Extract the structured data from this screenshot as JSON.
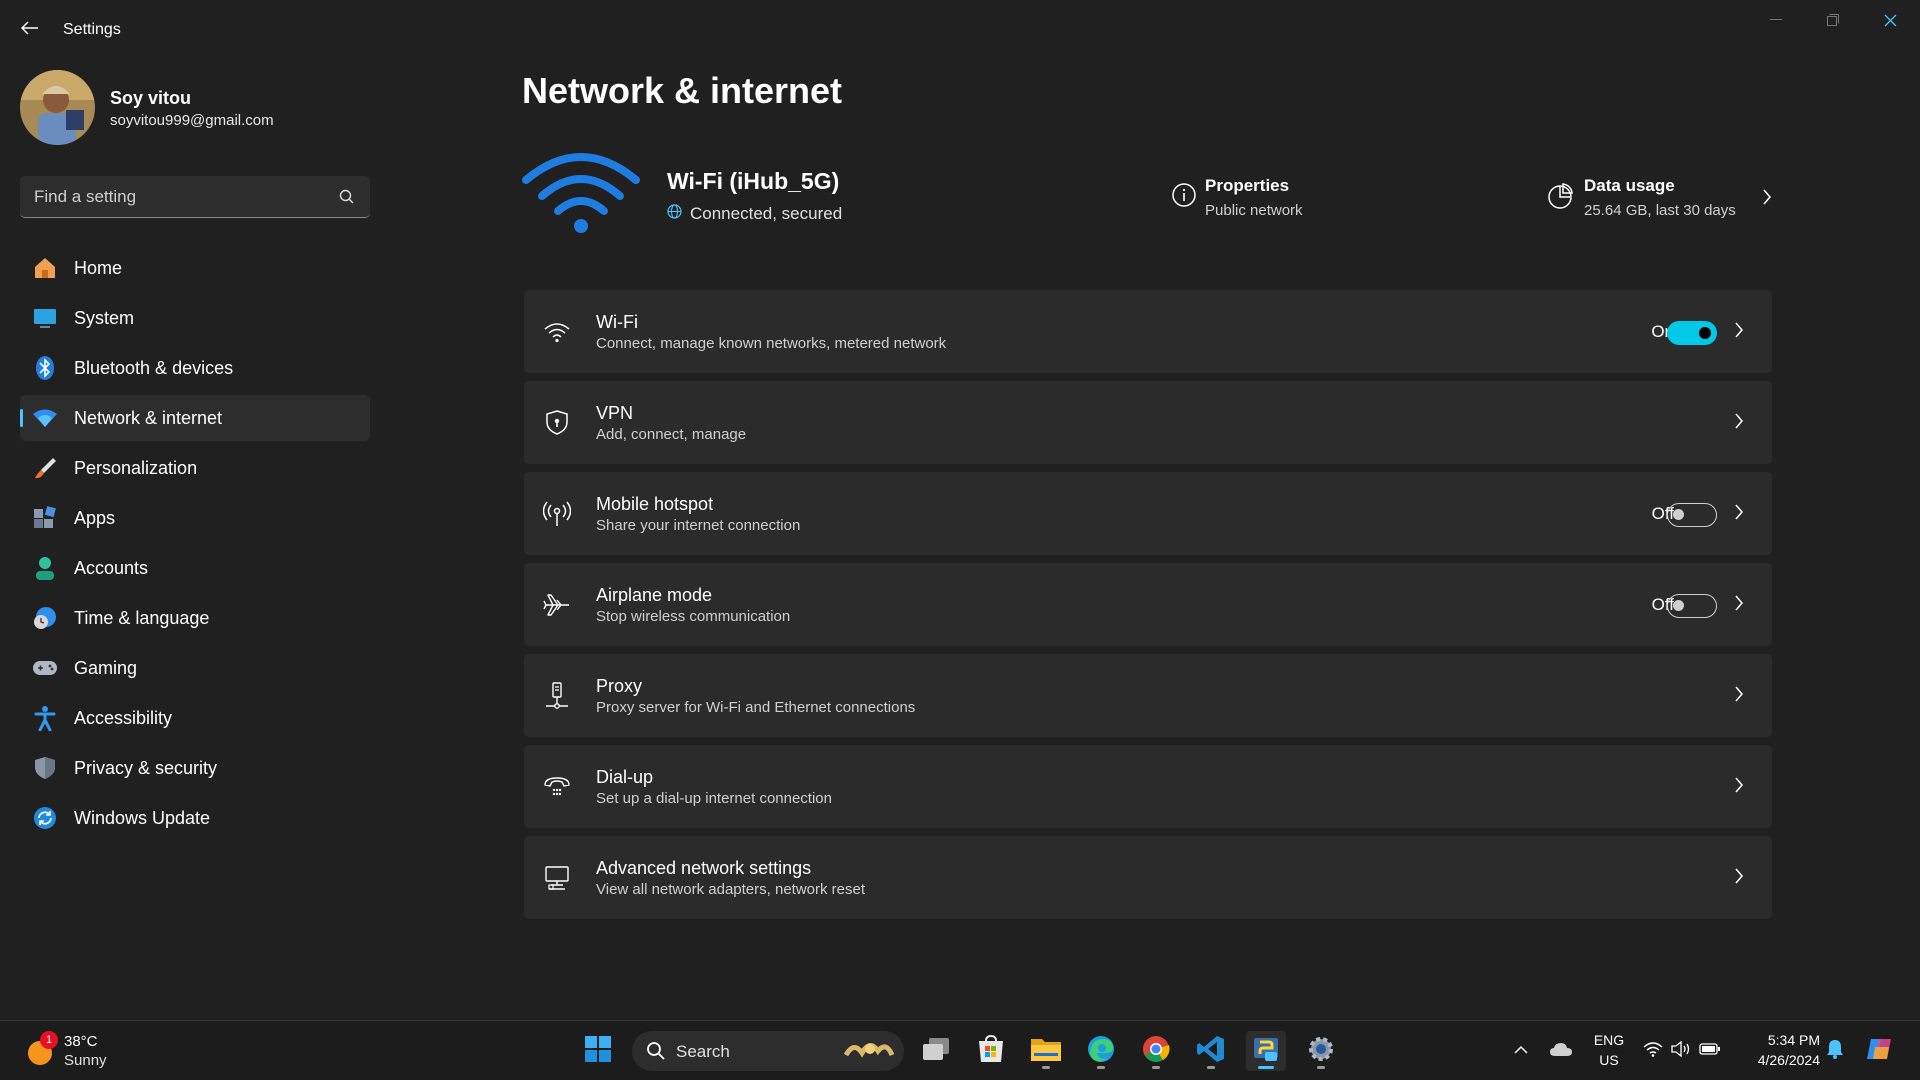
{
  "window": {
    "title": "Settings"
  },
  "profile": {
    "name": "Soy vitou",
    "email": "soyvitou999@gmail.com"
  },
  "search": {
    "placeholder": "Find a setting"
  },
  "sidebar": {
    "items": [
      {
        "label": "Home",
        "icon": "home-icon"
      },
      {
        "label": "System",
        "icon": "system-icon"
      },
      {
        "label": "Bluetooth & devices",
        "icon": "bluetooth-icon"
      },
      {
        "label": "Network & internet",
        "icon": "network-icon",
        "active": true
      },
      {
        "label": "Personalization",
        "icon": "brush-icon"
      },
      {
        "label": "Apps",
        "icon": "apps-icon"
      },
      {
        "label": "Accounts",
        "icon": "accounts-icon"
      },
      {
        "label": "Time & language",
        "icon": "time-language-icon"
      },
      {
        "label": "Gaming",
        "icon": "gaming-icon"
      },
      {
        "label": "Accessibility",
        "icon": "accessibility-icon"
      },
      {
        "label": "Privacy & security",
        "icon": "shield-icon"
      },
      {
        "label": "Windows Update",
        "icon": "update-icon"
      }
    ]
  },
  "main": {
    "title": "Network & internet",
    "hero": {
      "ssid": "Wi-Fi (iHub_5G)",
      "status": "Connected, secured",
      "properties_title": "Properties",
      "properties_sub": "Public network",
      "usage_title": "Data usage",
      "usage_sub": "25.64 GB, last 30 days"
    },
    "cards": [
      {
        "title": "Wi-Fi",
        "sub": "Connect, manage known networks, metered network",
        "state": "On",
        "icon": "wifi-icon"
      },
      {
        "title": "VPN",
        "sub": "Add, connect, manage",
        "icon": "vpn-shield-icon"
      },
      {
        "title": "Mobile hotspot",
        "sub": "Share your internet connection",
        "state": "Off",
        "icon": "hotspot-icon"
      },
      {
        "title": "Airplane mode",
        "sub": "Stop wireless communication",
        "state": "Off",
        "icon": "airplane-icon"
      },
      {
        "title": "Proxy",
        "sub": "Proxy server for Wi-Fi and Ethernet connections",
        "icon": "proxy-icon"
      },
      {
        "title": "Dial-up",
        "sub": "Set up a dial-up internet connection",
        "icon": "dialup-icon"
      },
      {
        "title": "Advanced network settings",
        "sub": "View all network adapters, network reset",
        "icon": "advanced-network-icon"
      }
    ]
  },
  "taskbar": {
    "weather_temp": "38°C",
    "weather_cond": "Sunny",
    "weather_badge": "1",
    "search_label": "Search",
    "lang_top": "ENG",
    "lang_bottom": "US",
    "time": "5:34 PM",
    "date": "4/26/2024"
  },
  "colors": {
    "accent": "#4cc2ff",
    "background": "#202020",
    "card": "#2b2b2b"
  }
}
